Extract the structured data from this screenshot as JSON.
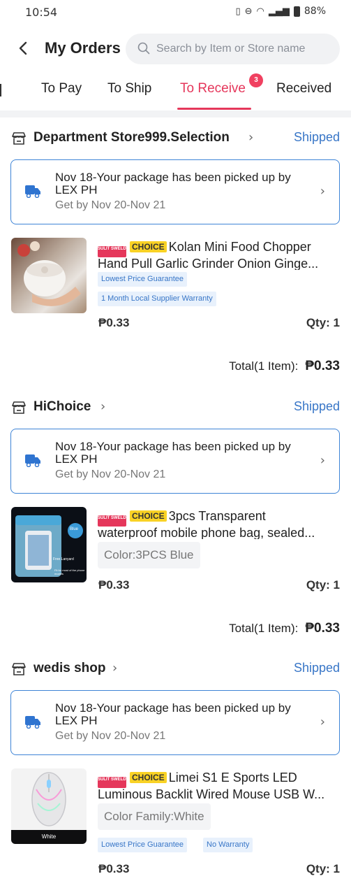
{
  "status_bar": {
    "time": "10:54",
    "battery": "88%"
  },
  "header": {
    "back_icon": "chevron-left-icon",
    "title": "My Orders",
    "search_placeholder": "Search by Item or Store name"
  },
  "tabs": [
    {
      "label": "To Pay",
      "active": false
    },
    {
      "label": "To Ship",
      "active": false
    },
    {
      "label": "To Receive",
      "active": true,
      "badge": "3"
    },
    {
      "label": "Received",
      "active": false
    }
  ],
  "colors": {
    "accent": "#e5375b",
    "link_blue": "#3876c7",
    "badge_yellow": "#f9d225"
  },
  "orders": [
    {
      "store": "Department Store999.Selection",
      "status": "Shipped",
      "tracking": {
        "message": "Nov 18-Your package has been picked up by LEX PH",
        "eta": "Get by Nov 20-Nov 21"
      },
      "product": {
        "badge_sulit": "SULIT SWELDO",
        "badge_choice": "CHOICE",
        "title_line1": "Kolan Mini Food Chopper",
        "title_line2": "Hand Pull Garlic Grinder Onion Ginge...",
        "tags": [
          "Lowest Price Guarantee",
          "1 Month Local Supplier Warranty"
        ],
        "price": "₱0.33",
        "qty": "Qty: 1"
      },
      "total_label": "Total(1 Item):",
      "total_amount": "₱0.33"
    },
    {
      "store": "HiChoice",
      "status": "Shipped",
      "tracking": {
        "message": "Nov 18-Your package has been picked up by LEX PH",
        "eta": "Get by Nov 20-Nov 21"
      },
      "product": {
        "badge_sulit": "SULIT SWELDO",
        "badge_choice": "CHOICE",
        "title_line1": "3pcs Transparent",
        "title_line2": "waterproof mobile phone bag, sealed...",
        "variant": "Color:3PCS Blue",
        "thumb_label_top": "Blue",
        "thumb_label_mid": "Free Lanyard",
        "thumb_label_bottom": "Fit for most of the phone models",
        "price": "₱0.33",
        "qty": "Qty: 1"
      },
      "total_label": "Total(1 Item):",
      "total_amount": "₱0.33"
    },
    {
      "store": "wedis shop",
      "status": "Shipped",
      "tracking": {
        "message": "Nov 18-Your package has been picked up by LEX PH",
        "eta": "Get by Nov 20-Nov 21"
      },
      "product": {
        "badge_sulit": "SULIT SWELDO",
        "badge_choice": "CHOICE",
        "title_line1": "Limei S1 E Sports LED",
        "title_line2": "Luminous Backlit Wired Mouse USB W...",
        "variant": "Color Family:White",
        "thumb_label": "White",
        "tags": [
          "Lowest Price Guarantee",
          "No Warranty"
        ],
        "price": "₱0.33",
        "qty": "Qty: 1"
      }
    }
  ]
}
